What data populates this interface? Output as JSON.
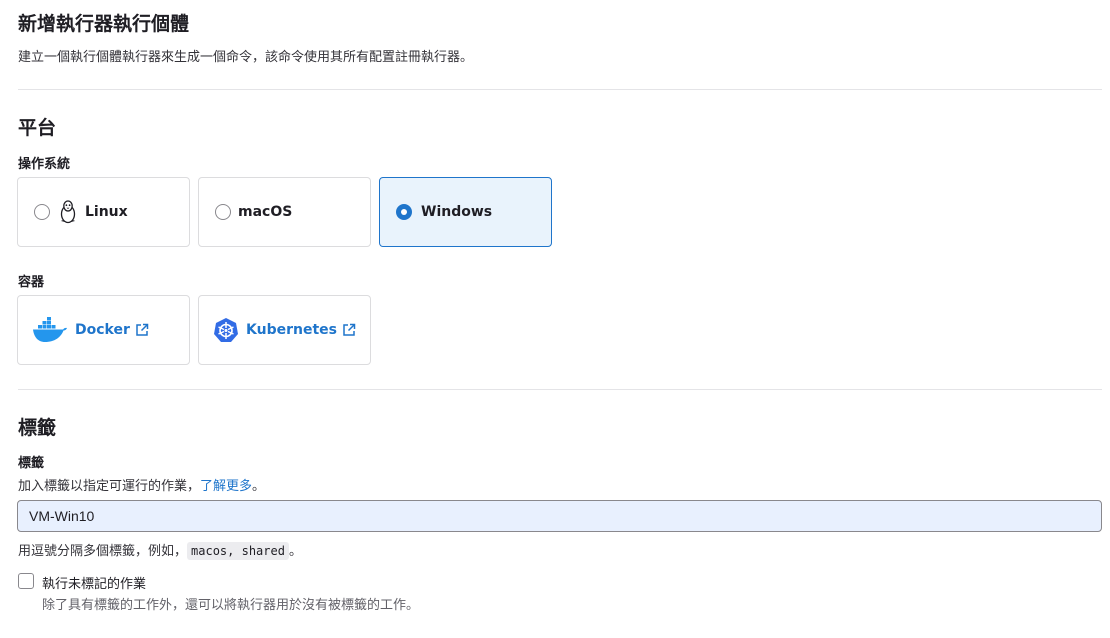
{
  "header": {
    "title": "新增執行器執行個體",
    "description": "建立一個執行個體執行器來生成一個命令，該命令使用其所有配置註冊執行器。"
  },
  "platform": {
    "title": "平台",
    "os_label": "操作系統",
    "os_options": [
      {
        "label": "Linux",
        "icon": "linux-penguin-icon",
        "selected": false
      },
      {
        "label": "macOS",
        "selected": false
      },
      {
        "label": "Windows",
        "selected": true
      }
    ],
    "containers_label": "容器",
    "containers": [
      {
        "label": "Docker",
        "icon": "docker-icon"
      },
      {
        "label": "Kubernetes",
        "icon": "kubernetes-icon"
      }
    ]
  },
  "tags": {
    "title": "標籤",
    "field_label": "標籤",
    "help_prefix": "加入標籤以指定可運行的作業，",
    "help_link": "了解更多",
    "help_suffix": "。",
    "value": "VM-Win10",
    "format_prefix": "用逗號分隔多個標籤，例如，",
    "format_example": "macos, shared",
    "format_suffix": "。",
    "run_untagged_label": "執行未標記的作業",
    "run_untagged_help": "除了具有標籤的工作外，還可以將執行器用於沒有被標籤的工作。",
    "run_untagged_checked": false
  },
  "colors": {
    "accent": "#1f75cb",
    "selected_bg": "#e9f3fc",
    "input_bg": "#e8f0fe"
  }
}
